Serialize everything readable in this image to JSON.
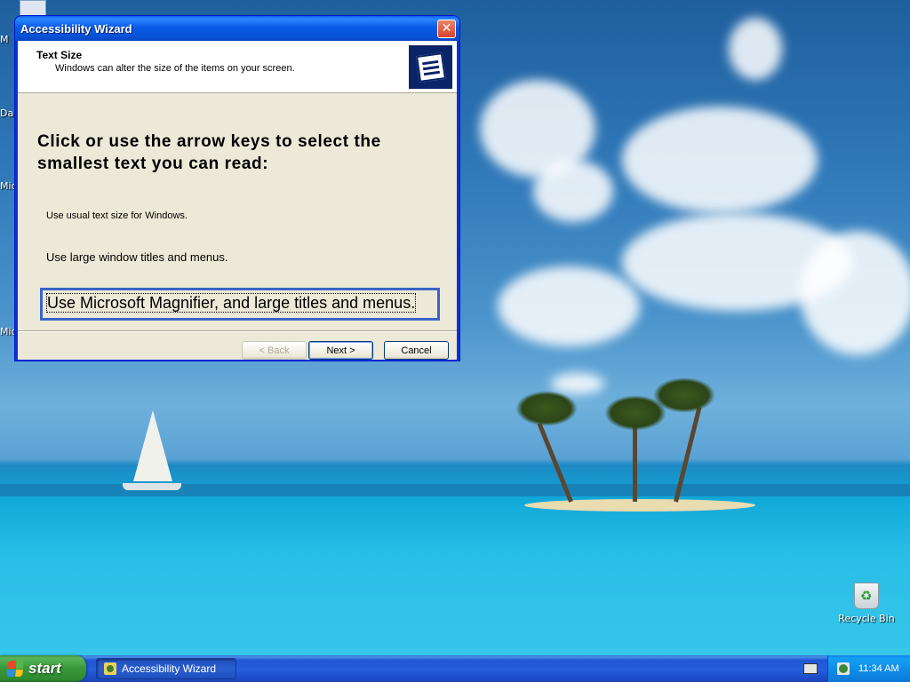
{
  "window": {
    "title": "Accessibility Wizard",
    "header_title": "Text Size",
    "header_subtitle": "Windows can alter the size of the items on your screen.",
    "prompt": "Click or use the arrow keys to select the smallest text you can read:",
    "options": [
      "Use usual text size for Windows.",
      "Use large window titles and menus.",
      "Use Microsoft Magnifier, and large titles and menus."
    ],
    "selected_option": 2,
    "buttons": {
      "back": "< Back",
      "next": "Next >",
      "cancel": "Cancel"
    },
    "close_glyph": "✕"
  },
  "desktop": {
    "edge_labels": [
      "M",
      "Da",
      "Mic",
      "Mic"
    ],
    "recycle_bin_label": "Recycle Bin"
  },
  "taskbar": {
    "start_label": "start",
    "task_item": "Accessibility Wizard",
    "clock": "11:34 AM"
  },
  "colors": {
    "title_bar": "#0a5be6",
    "dialog_face": "#ece9d8",
    "selection_border": "#3a65c7",
    "taskbar": "#245edb",
    "start_button": "#3a9a3a"
  },
  "icons": [
    "close-icon",
    "wizard-logo-icon",
    "windows-flag-icon",
    "recycle-bin-icon",
    "keyboard-icon",
    "tray-network-icon",
    "task-accessibility-icon"
  ]
}
